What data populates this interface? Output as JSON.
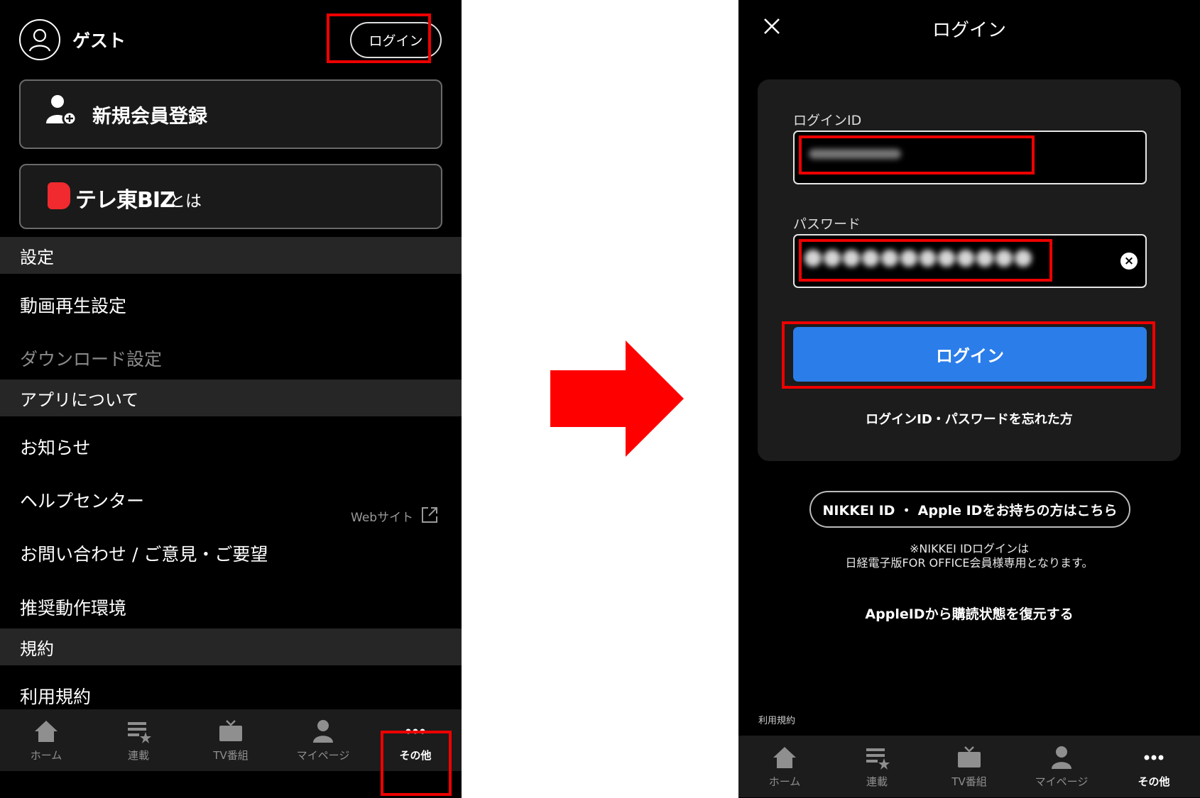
{
  "left": {
    "user_name": "ゲスト",
    "login_button": "ログイン",
    "register_label": "新規会員登録",
    "biz_name": "テレ東BIZ",
    "biz_suffix": "とは",
    "sections": [
      {
        "header": "設定",
        "items": [
          "動画再生設定",
          "ダウンロード設定"
        ]
      },
      {
        "header": "アプリについて",
        "items": [
          "お知らせ",
          "ヘルプセンター",
          "お問い合わせ / ご意見・ご要望",
          "推奨動作環境"
        ]
      },
      {
        "header": "規約",
        "items": [
          "利用規約"
        ]
      }
    ],
    "web_site_label": "Webサイト"
  },
  "tabbar": {
    "tabs": [
      "ホーム",
      "連載",
      "TV番組",
      "マイページ",
      "その他"
    ],
    "active": "その他"
  },
  "right": {
    "title": "ログイン",
    "login_id_label": "ログインID",
    "password_label": "パスワード",
    "login_button": "ログイン",
    "forgot_link": "ログインID・パスワードを忘れた方",
    "nikkei_button": "NIKKEI ID ・ Apple IDをお持ちの方はこちら",
    "note_line1": "※NIKKEI IDログインは",
    "note_line2": "日経電子版FOR OFFICE会員様専用となります。",
    "restore_link": "AppleIDから購読状態を復元する",
    "cut_off_text": "利用規約"
  },
  "colors": {
    "highlight": "#e00000",
    "primary": "#2b7de9",
    "biz_red": "#f02a2e",
    "arrow": "#ff0000"
  },
  "icons": [
    "person-circle-icon",
    "add-user-icon",
    "external-link-icon",
    "home-icon",
    "list-star-icon",
    "tv-icon",
    "person-icon",
    "more-icon",
    "close-icon",
    "clear-icon",
    "right-arrow-icon"
  ]
}
